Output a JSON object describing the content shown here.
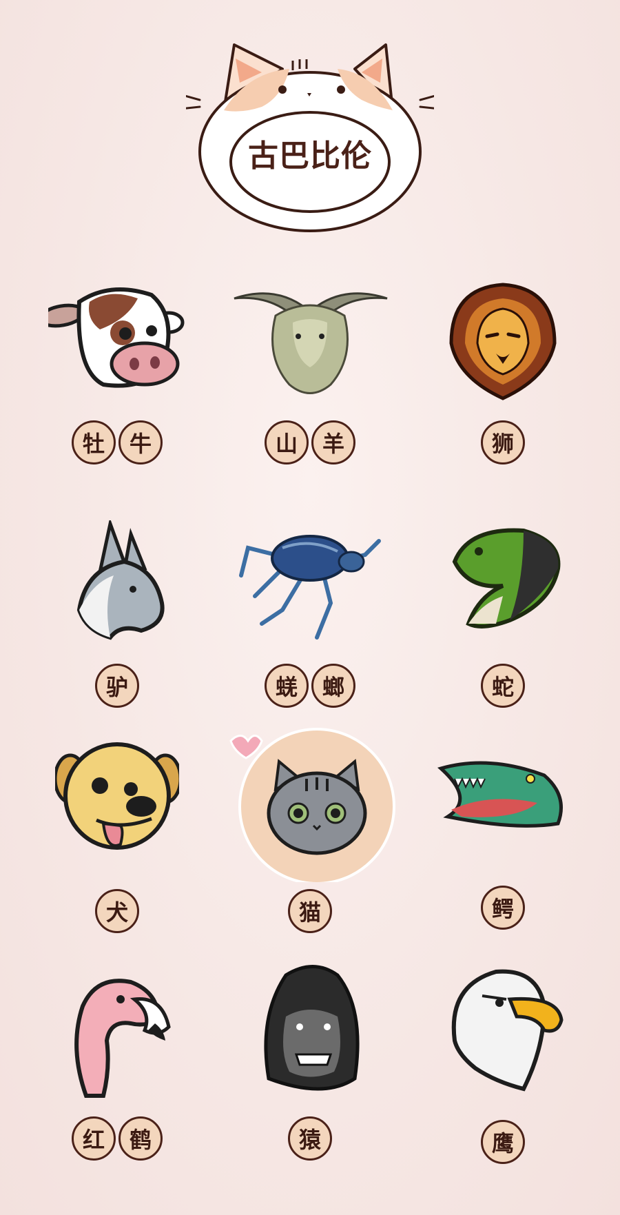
{
  "header": {
    "title": "古巴比伦"
  },
  "animals": [
    {
      "icon": "cow-head-icon",
      "chars": [
        "牡",
        "牛"
      ]
    },
    {
      "icon": "goat-head-icon",
      "chars": [
        "山",
        "羊"
      ]
    },
    {
      "icon": "lion-head-icon",
      "chars": [
        "狮"
      ]
    },
    {
      "icon": "donkey-head-icon",
      "chars": [
        "驴"
      ]
    },
    {
      "icon": "scarab-beetle-icon",
      "chars": [
        "蜣",
        "螂"
      ]
    },
    {
      "icon": "snake-head-icon",
      "chars": [
        "蛇"
      ]
    },
    {
      "icon": "dog-head-icon",
      "chars": [
        "犬"
      ]
    },
    {
      "icon": "cat-head-icon",
      "chars": [
        "猫"
      ]
    },
    {
      "icon": "crocodile-head-icon",
      "chars": [
        "鳄"
      ]
    },
    {
      "icon": "flamingo-head-icon",
      "chars": [
        "红",
        "鹤"
      ]
    },
    {
      "icon": "gorilla-head-icon",
      "chars": [
        "猿"
      ]
    },
    {
      "icon": "eagle-head-icon",
      "chars": [
        "鹰"
      ]
    }
  ],
  "colors": {
    "background": "#f6e7e4",
    "badge_fill": "#f3d6bd",
    "badge_border": "#4a2118",
    "text": "#3b1a12",
    "highlight": "#f3d3b8"
  }
}
